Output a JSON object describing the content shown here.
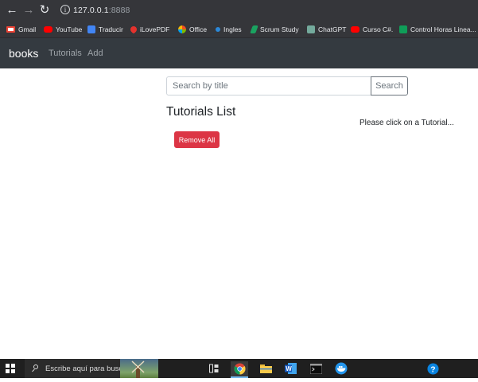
{
  "browser": {
    "url_host": "127.0.0.1",
    "url_port": ":8888",
    "bookmarks": [
      {
        "label": "Gmail",
        "icon": "gmail-icon",
        "color": "#ea4335"
      },
      {
        "label": "YouTube",
        "icon": "youtube-icon",
        "color": "#ff0000"
      },
      {
        "label": "Traducir",
        "icon": "translate-icon",
        "color": "#4285f4"
      },
      {
        "label": "iLovePDF",
        "icon": "ilovepdf-icon",
        "color": "#e5322d"
      },
      {
        "label": "Office",
        "icon": "office-icon",
        "color": "#7b83eb"
      },
      {
        "label": "Ingles",
        "icon": "ingles-icon",
        "color": "#2b88d8"
      },
      {
        "label": "Scrum Study",
        "icon": "scrumstudy-icon",
        "color": "#1aa260"
      },
      {
        "label": "ChatGPT",
        "icon": "chatgpt-icon",
        "color": "#74aa9c"
      },
      {
        "label": "Curso C#.",
        "icon": "youtube-icon",
        "color": "#ff0000"
      },
      {
        "label": "Control Horas Linea...",
        "icon": "sheets-icon",
        "color": "#0f9d58"
      }
    ]
  },
  "navbar": {
    "brand": "books",
    "links": [
      "Tutorials",
      "Add"
    ]
  },
  "search": {
    "placeholder": "Search by title",
    "button_label": "Search"
  },
  "list": {
    "title": "Tutorials List",
    "remove_all_label": "Remove All"
  },
  "detail": {
    "hint": "Please click on a Tutorial..."
  },
  "taskbar": {
    "search_placeholder": "Escribe aquí para buscar."
  },
  "colors": {
    "navbar_bg": "#343a40",
    "danger": "#dc3545",
    "chrome_bg": "#35363a",
    "taskbar_bg": "#1f1f1f"
  }
}
